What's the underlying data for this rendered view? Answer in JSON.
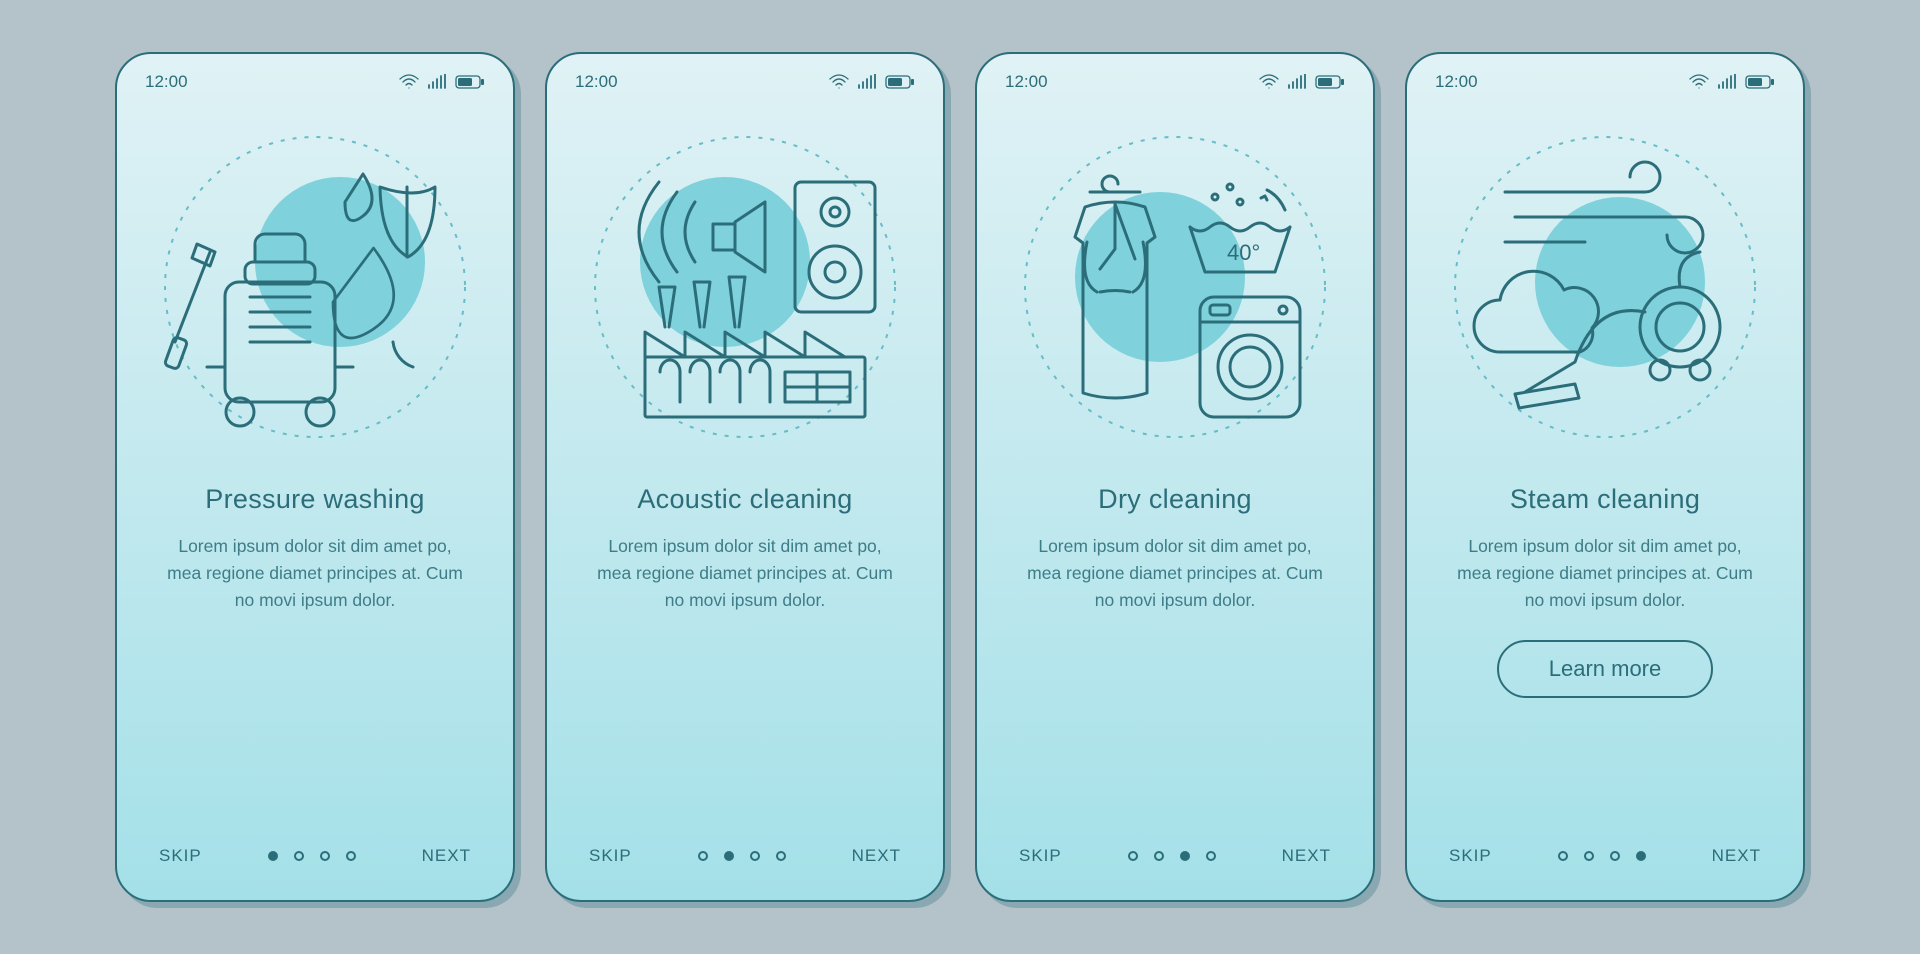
{
  "status_time": "12:00",
  "screens": [
    {
      "title": "Pressure washing",
      "desc": "Lorem ipsum dolor sit dim amet po, mea regione diamet principes at. Cum no movi ipsum dolor.",
      "skip": "SKIP",
      "next": "NEXT",
      "active_dot": 0
    },
    {
      "title": "Acoustic cleaning",
      "desc": "Lorem ipsum dolor sit dim amet po, mea regione diamet principes at. Cum no movi ipsum dolor.",
      "skip": "SKIP",
      "next": "NEXT",
      "active_dot": 1
    },
    {
      "title": "Dry cleaning",
      "desc": "Lorem ipsum dolor sit dim amet po, mea regione diamet principes at. Cum no movi ipsum dolor.",
      "skip": "SKIP",
      "next": "NEXT",
      "active_dot": 2
    },
    {
      "title": "Steam cleaning",
      "desc": "Lorem ipsum dolor sit dim amet po, mea regione diamet principes at. Cum no movi ipsum dolor.",
      "skip": "SKIP",
      "next": "NEXT",
      "learn_more": "Learn more",
      "active_dot": 3
    }
  ]
}
